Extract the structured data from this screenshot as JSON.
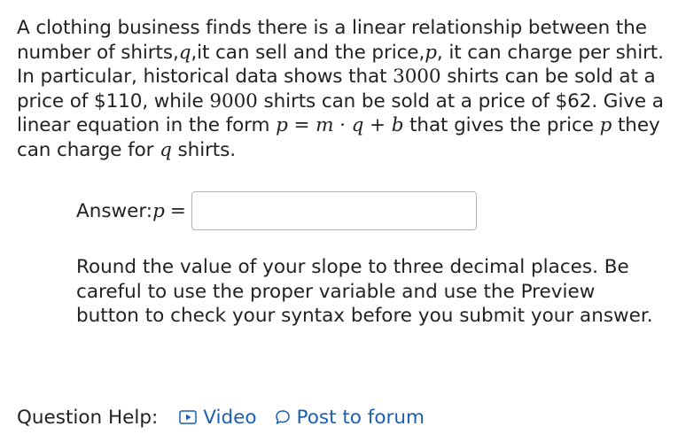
{
  "problem": {
    "t1": "A clothing business finds there is a linear relationship between the number of shirts,",
    "var_q": "q",
    "t2": ",it can sell and the price,",
    "var_p": "p",
    "t3": ", it can charge per shirt. In particular, historical data shows that ",
    "num1": "3000",
    "t4": " shirts can be sold at a price of $110, while ",
    "num2": "9000",
    "t5": " shirts can be sold at a price of $62. Give a linear equation in the form ",
    "formula_p": "p",
    "formula_eq": " = ",
    "formula_m": "m",
    "formula_dot": " · ",
    "formula_q": "q",
    "formula_plus": " + ",
    "formula_b": "b",
    "t6": " that gives the price ",
    "var_p2": "p",
    "t7": " they can charge for ",
    "var_q2": "q",
    "t8": " shirts."
  },
  "answer": {
    "label": "Answer: ",
    "var": "p",
    "eq": "=",
    "value": ""
  },
  "note": "Round the value of your slope to three decimal places. Be careful to use the proper variable and use the Preview button to check your syntax before you submit your answer.",
  "help": {
    "label": "Question Help:",
    "video": "Video",
    "forum": "Post to forum"
  },
  "colors": {
    "link": "#1a5fb4",
    "text": "#222222",
    "border": "#b5b5b5"
  }
}
